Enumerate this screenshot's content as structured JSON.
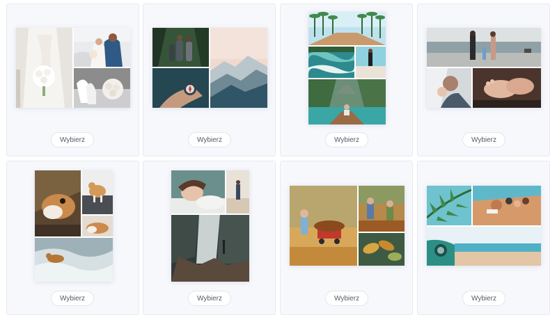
{
  "templates": [
    {
      "button_label": "Wybierz",
      "photos": [
        "bride-with-bouquet",
        "wedding-couple",
        "wedding-shoes-and-bouquet"
      ]
    },
    {
      "button_label": "Wybierz",
      "photos": [
        "hikers-in-forest",
        "misty-mountains",
        "hand-with-compass",
        "mountain-valley"
      ]
    },
    {
      "button_label": "Wybierz",
      "photos": [
        "palm-tree-path",
        "ocean-waves-aerial",
        "woman-on-beach",
        "canoe-in-lagoon"
      ]
    },
    {
      "button_label": "Wybierz",
      "photos": [
        "family-on-beach",
        "father-with-baby",
        "baby-feet"
      ]
    },
    {
      "button_label": "Wybierz",
      "photos": [
        "corgi-on-rug",
        "corgi-standing",
        "corgi-lying",
        "dog-in-sea-waves"
      ]
    },
    {
      "button_label": "Wybierz",
      "photos": [
        "sleeping-woman",
        "woman-walking",
        "waterfall-cliff"
      ]
    },
    {
      "button_label": "Wybierz",
      "photos": [
        "child-with-leaf-wagon",
        "children-in-autumn-leaves",
        "autumn-leaves-closeup"
      ]
    },
    {
      "button_label": "Wybierz",
      "photos": [
        "palm-leaf",
        "friends-on-beach-aerial",
        "car-by-the-sea"
      ]
    }
  ],
  "colors": {
    "card_background": "#f7f8fb",
    "card_border": "#e7e9ef",
    "button_text": "#555b66"
  }
}
